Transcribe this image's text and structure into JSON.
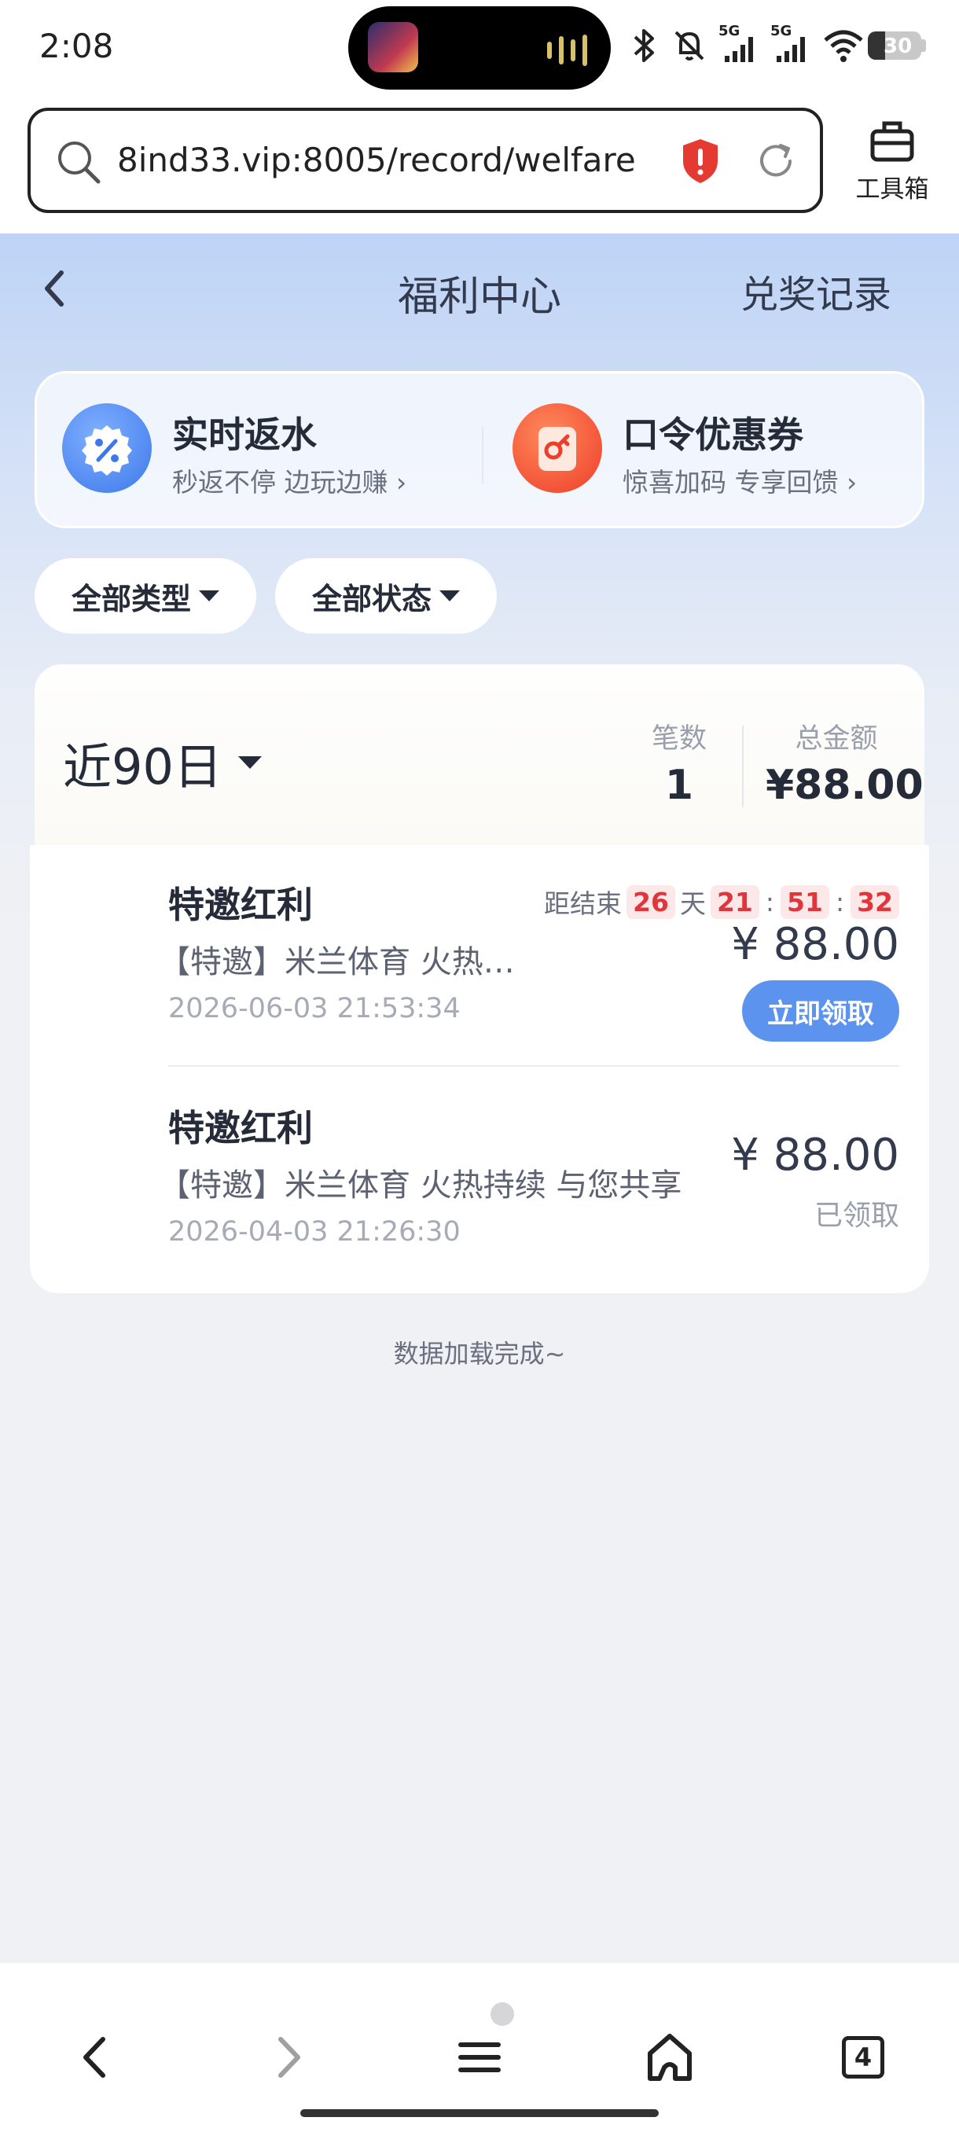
{
  "status_bar": {
    "time": "2:08",
    "battery": "30",
    "network_labels": [
      "5G",
      "5G"
    ],
    "icons": [
      "media-thumbnail-icon",
      "audio-wave-icon",
      "bluetooth-icon",
      "mute-bell-icon",
      "signal-icon",
      "signal-icon",
      "wifi-icon",
      "battery-icon"
    ]
  },
  "browser": {
    "url": "8ind33.vip:8005/record/welfare",
    "toolbox_label": "工具箱",
    "tabs_count": "4",
    "icons": [
      "search-icon",
      "security-shield-icon",
      "reload-icon",
      "toolbox-icon",
      "back-icon",
      "forward-icon",
      "menu-icon",
      "home-icon",
      "tabs-icon"
    ]
  },
  "nav": {
    "title": "福利中心",
    "right_link": "兑奖记录"
  },
  "promos": [
    {
      "title": "实时返水",
      "subtitle": "秒返不停 边玩边赚",
      "icon": "percent-badge-icon",
      "color": "#4b86f0"
    },
    {
      "title": "口令优惠券",
      "subtitle": "惊喜加码 专享回馈",
      "icon": "key-coupon-icon",
      "color": "#f25a3a"
    }
  ],
  "filters": {
    "type": "全部类型",
    "status": "全部状态"
  },
  "summary": {
    "period": "近90日",
    "count_label": "笔数",
    "count_value": "1",
    "total_label": "总金额",
    "total_value": "¥88.00"
  },
  "records": [
    {
      "title": "特邀红利",
      "description": "【特邀】米兰体育 火热…",
      "date": "2026-06-03 21:53:34",
      "amount": "¥ 88.00",
      "countdown": {
        "label": "距结束",
        "days": "26",
        "day_unit": "天",
        "hours": "21",
        "minutes": "51",
        "seconds": "32",
        "sep": ":"
      },
      "action": "立即领取"
    },
    {
      "title": "特邀红利",
      "description": "【特邀】米兰体育 火热持续 与您共享",
      "date": "2026-04-03 21:26:30",
      "amount": "¥ 88.00",
      "status": "已领取"
    }
  ],
  "footer_note": "数据加载完成~",
  "colors": {
    "accent": "#5b93ef",
    "countdown_red": "#e0353b",
    "header_gradient_top": "#bed3f6",
    "background": "#f0f1f4"
  }
}
